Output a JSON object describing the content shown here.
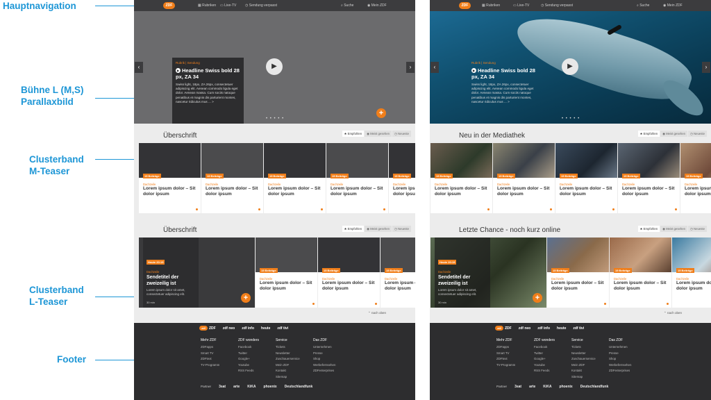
{
  "annotations": [
    {
      "label": "Hauptnavigation",
      "name": "annotation-hauptnavigation"
    },
    {
      "label": "Bühne L (M,S) Parallaxbild",
      "name": "annotation-buehne"
    },
    {
      "label": "Clusterband M-Teaser",
      "name": "annotation-clusterband-m"
    },
    {
      "label": "Clusterband L-Teaser",
      "name": "annotation-clusterband-l"
    },
    {
      "label": "Footer",
      "name": "annotation-footer"
    }
  ],
  "nav": {
    "logo": "ZDF",
    "items": [
      "Rubriken",
      "Live-TV",
      "Sendung verpasst"
    ],
    "search": "Suche",
    "account": "Mein ZDF"
  },
  "stage": {
    "rubrik": "Rubrik | Sendung",
    "headline": "Headline Swiss bold 28 px, ZA 34",
    "body": "Swiss light, 18px, ZA 26px, consectetuer adipiscing elit. Aenean commodo ligula eget dolor. Aenean massa. Cum sociis natoque penatibus et magnis dis parturient montes, nascetur ridiculus mus ... >",
    "dots": "• • • • •",
    "plus": "+"
  },
  "tabs": [
    "Empfohlen",
    "Meist gesehen",
    "Neueste"
  ],
  "card": {
    "badge": "15 Beiträge",
    "kicker": "Dachzeile",
    "title": "Lorem ipsum dolor – Sit dolor ipsum"
  },
  "lteaser": {
    "badge": "Heute 20:15",
    "kicker": "Dachzeile",
    "headline": "Sendetitel der zweizeilig ist",
    "body": "Lorem ipsum dolor sit amet, consectetuer adipiscing elit.",
    "duration": "30 min"
  },
  "more_label": "nach oben",
  "left": {
    "band1_title": "Überschrift",
    "band2_title": "Überschrift"
  },
  "right": {
    "band1_title": "Neu in der Mediathek",
    "band2_title": "Letzte Chance - noch kurz online"
  },
  "footer": {
    "logos": [
      "ZDF",
      "zdf neo",
      "zdf info",
      "heute",
      "zdf tivi"
    ],
    "columns": [
      {
        "head": "Mehr ZDF",
        "items": [
          "ZDFapps",
          "Smart TV",
          "ZDFtext",
          "TV-Programm"
        ]
      },
      {
        "head": "ZDF wonders",
        "items": [
          "Facebook",
          "Twitter",
          "Google+",
          "Youtube",
          "RSS Feeds"
        ]
      },
      {
        "head": "Service",
        "items": [
          "Tickets",
          "Newsletter",
          "Zuschauerservice",
          "Mein ZDF",
          "Kontakt",
          "Sitemap"
        ]
      },
      {
        "head": "Das ZDF",
        "items": [
          "Unternehmen",
          "Presse",
          "Shop",
          "Werbefernsehen",
          "ZDFenterprises"
        ]
      }
    ],
    "partners_label": "Partner",
    "partners": [
      "3sat",
      "arte",
      "KiKA",
      "phoenix",
      "Deutschlandfunk"
    ]
  },
  "colors": {
    "accent": "#f07e1a",
    "annotation": "#1d96d6",
    "nav": "#3c3c3e",
    "footer": "#2d2d2f"
  }
}
